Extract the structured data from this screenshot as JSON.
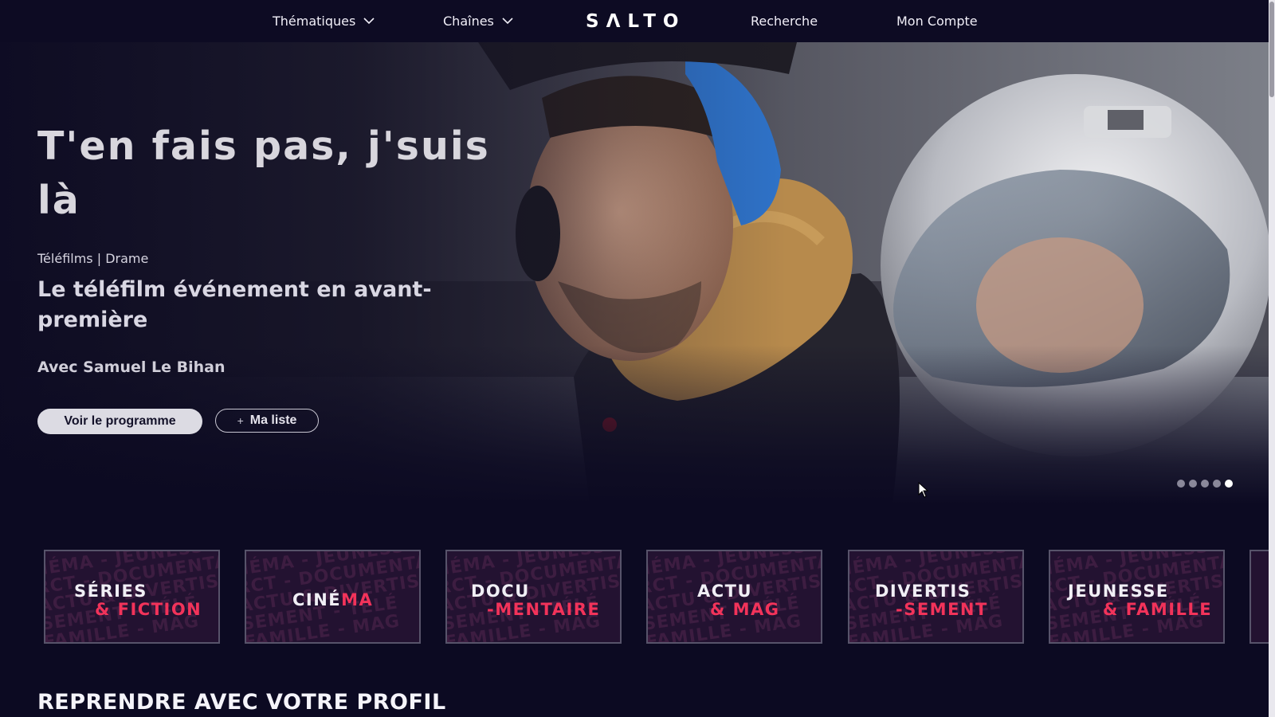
{
  "nav": {
    "items": [
      {
        "label": "Thématiques",
        "has_dropdown": true
      },
      {
        "label": "Chaînes",
        "has_dropdown": true
      },
      {
        "label": "Recherche",
        "has_dropdown": false
      },
      {
        "label": "Mon Compte",
        "has_dropdown": false
      }
    ],
    "logo": "SΛLTO",
    "dropdown_icon": "chevron-down-icon"
  },
  "hero": {
    "title": "T'en fais pas, j'suis là",
    "category": "Téléfilms | Drame",
    "tagline": "Le téléfilm événement en avant-première",
    "cast": "Avec Samuel Le Bihan",
    "primary_button": "Voir le programme",
    "secondary_button": "Ma liste",
    "secondary_icon": "plus-icon",
    "slides_total": 5,
    "active_slide": 5
  },
  "categories": [
    {
      "line1": "SÉRIES",
      "line2": "& FICTION",
      "watermark": [
        "NÉMA - JEUNESSE",
        "RCT - DOCUMENTAIRE",
        "ACTU & DIVERTIS",
        "SEMENT - TÉLÉ",
        "FAMILLE - MAG"
      ]
    },
    {
      "single_white": "CINÉ",
      "single_accent": "MA",
      "watermark": [
        "NÉMA - JEUNESSE",
        "RCT - DOCUMENTAIRE",
        "ACTU & DIVERTIS",
        "SEMENT - TÉLÉ",
        "FAMILLE - MAG"
      ]
    },
    {
      "line1": "DOCU",
      "line2": "-MENTAIRE",
      "watermark": [
        "NÉMA - JEUNESSE",
        "RCT - DOCUMENTAIRE",
        "ACTU & DIVERTIS",
        "SEMENT - TÉLÉ",
        "FAMILLE - MAG"
      ]
    },
    {
      "line1": "ACTU",
      "line2": "& MAG",
      "watermark": [
        "NÉMA - JEUNESSE",
        "RCT - DOCUMENTAIRE",
        "ACTU & DIVERTIS",
        "SEMENT - TÉLÉ",
        "FAMILLE - MAG"
      ]
    },
    {
      "line1": "DIVERTIS",
      "line2": "-SEMENT",
      "watermark": [
        "NÉMA - JEUNESSE",
        "RCT - DOCUMENTAIRE",
        "ACTU & DIVERTIS",
        "SEMENT - TÉLÉ",
        "FAMILLE - MAG"
      ]
    },
    {
      "line1": "JEUNESSE",
      "line2": "& FAMILLE",
      "watermark": [
        "NÉMA - JEUNESSE",
        "RCT - DOCUMENTAIRE",
        "ACTU & DIVERTIS",
        "SEMENT - TÉLÉ",
        "FAMILLE - MAG"
      ]
    }
  ],
  "section": {
    "title": "REPRENDRE AVEC VOTRE PROFIL"
  },
  "colors": {
    "background": "#0c0a22",
    "accent": "#f2335a",
    "tile_bg": "#231231",
    "text": "#ffffff"
  }
}
